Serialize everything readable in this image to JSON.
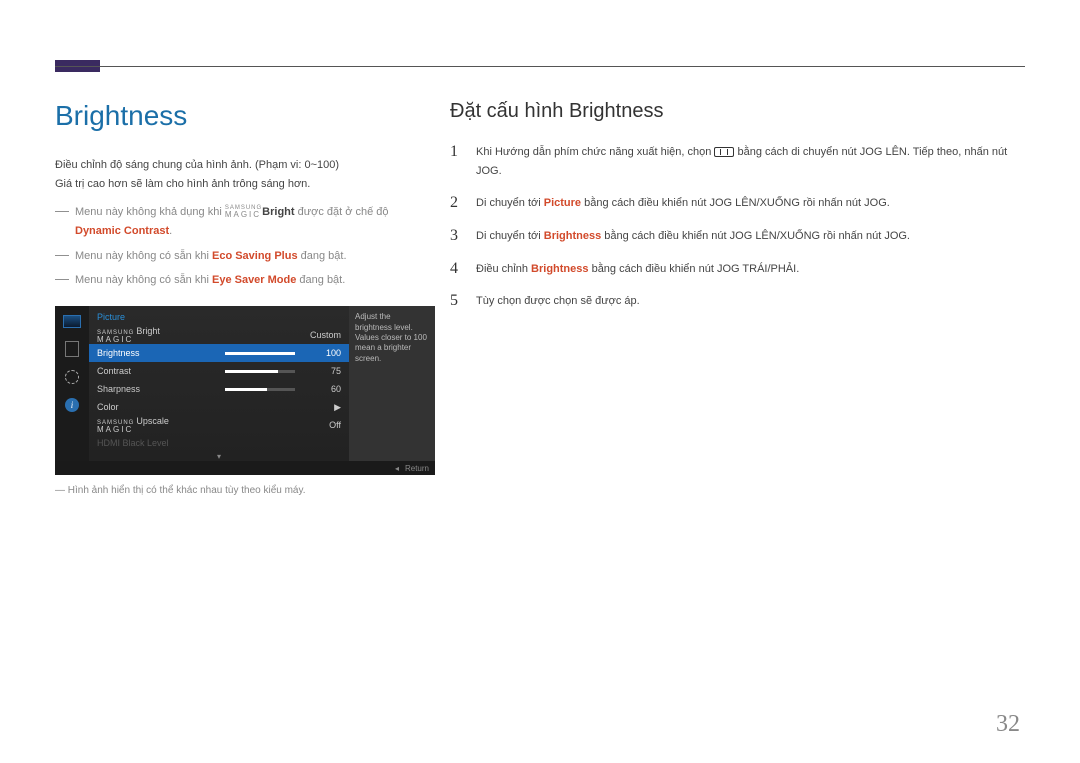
{
  "page_number": "32",
  "left": {
    "title": "Brightness",
    "p1": "Điều chỉnh độ sáng chung của hình ảnh. (Phạm vi: 0~100)",
    "p2": "Giá trị cao hơn sẽ làm cho hình ảnh trông sáng hơn.",
    "bullets": [
      {
        "pre": "Menu này không khả dụng khi ",
        "magic_small": "SAMSUNG",
        "magic": "MAGIC",
        "magic_suffix": "Bright",
        "mid": " được đặt ở chế độ ",
        "hi": "Dynamic Contrast",
        "post": "."
      },
      {
        "pre": "Menu này không có sẵn khi ",
        "hi": "Eco Saving Plus",
        "post": " đang bật."
      },
      {
        "pre": "Menu này không có sẵn khi ",
        "hi": "Eye Saver Mode",
        "post": " đang bật."
      }
    ],
    "image_note": "Hình ảnh hiển thị có thể khác nhau tùy theo kiểu máy."
  },
  "osd": {
    "title": "Picture",
    "help": "Adjust the brightness level. Values closer to 100 mean a brighter screen.",
    "samsung_label": "SAMSUNG",
    "magic_label": "MAGIC",
    "rows": [
      {
        "label_suffix": "Bright",
        "is_magic": true,
        "value": "Custom"
      },
      {
        "label": "Brightness",
        "value": "100",
        "bar": 100,
        "selected": true
      },
      {
        "label": "Contrast",
        "value": "75",
        "bar": 75
      },
      {
        "label": "Sharpness",
        "value": "60",
        "bar": 60
      },
      {
        "label": "Color",
        "arrow": "▶"
      },
      {
        "label_suffix": "Upscale",
        "is_magic": true,
        "value": "Off"
      },
      {
        "label": "HDMI Black Level",
        "disabled": true
      }
    ],
    "footer_return": "Return"
  },
  "right": {
    "heading": "Đặt cấu hình Brightness",
    "steps": [
      {
        "n": "1",
        "parts": [
          "Khi Hướng dẫn phím chức năng xuất hiện, chọn ",
          {
            "icon": true
          },
          " bằng cách di chuyển nút JOG LÊN. Tiếp theo, nhấn nút JOG."
        ]
      },
      {
        "n": "2",
        "parts": [
          "Di chuyển tới ",
          {
            "hi": "Picture"
          },
          " bằng cách điều khiển nút JOG LÊN/XUỐNG rồi nhấn nút JOG."
        ]
      },
      {
        "n": "3",
        "parts": [
          "Di chuyển tới ",
          {
            "hi": "Brightness"
          },
          " bằng cách điều khiển nút JOG LÊN/XUỐNG rồi nhấn nút JOG."
        ]
      },
      {
        "n": "4",
        "parts": [
          "Điều chỉnh ",
          {
            "hi": "Brightness"
          },
          " bằng cách điều khiển nút JOG TRÁI/PHẢI."
        ]
      },
      {
        "n": "5",
        "parts": [
          "Tùy chọn được chọn sẽ được áp."
        ]
      }
    ]
  }
}
